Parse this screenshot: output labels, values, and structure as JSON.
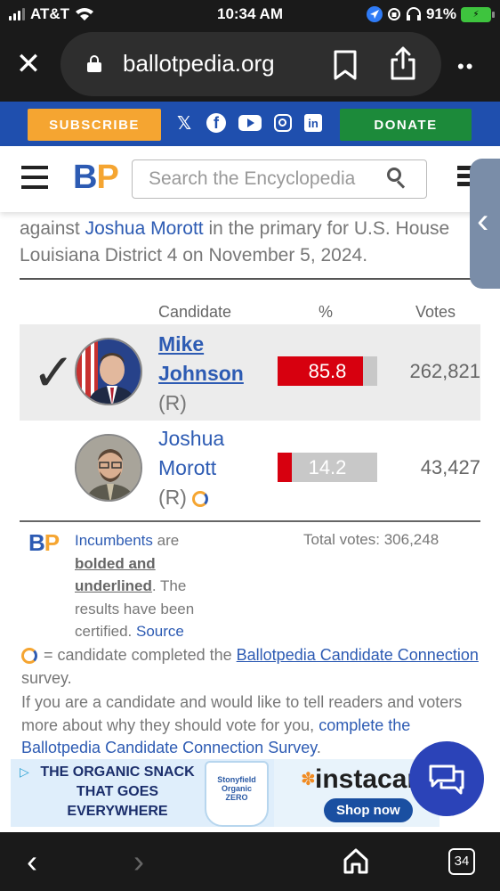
{
  "status_bar": {
    "carrier": "AT&T",
    "time": "10:34 AM",
    "battery": "91%"
  },
  "browser": {
    "url": "ballotpedia.org"
  },
  "site_bar": {
    "subscribe": "SUBSCRIBE",
    "donate": "DONATE",
    "social": [
      "x-icon",
      "facebook-icon",
      "youtube-icon",
      "instagram-icon",
      "linkedin-icon"
    ]
  },
  "site_header": {
    "logo_b": "B",
    "logo_p": "P",
    "search_placeholder": "Search the Encyclopedia"
  },
  "intro": {
    "text1": "against ",
    "link": "Joshua Morott",
    "text2": " in the primary for U.S. House Louisiana District 4 on November 5, 2024."
  },
  "table": {
    "headers": {
      "candidate": "Candidate",
      "percent": "%",
      "votes": "Votes"
    },
    "rows": [
      {
        "name_line1": "Mike",
        "name_line2": "Johnson",
        "party": "(R)",
        "percent": "85.8",
        "percent_value": 85.8,
        "votes": "262,821",
        "winner": true,
        "incumbent": true
      },
      {
        "name_line1": "Joshua",
        "name_line2": "Morott",
        "party": "(R)",
        "percent": "14.2",
        "percent_value": 14.2,
        "votes": "43,427",
        "winner": false,
        "incumbent": false
      }
    ]
  },
  "footnote": {
    "logo_b": "B",
    "logo_p": "P",
    "incumbents": "Incumbents",
    "are": " are",
    "bolded": "bolded and underlined",
    "rest": ". The results have been certified. ",
    "source": "Source",
    "total_votes": "Total votes: 306,248"
  },
  "cc_line": {
    "text1": " = candidate completed the ",
    "link": "Ballotpedia Candidate Connection",
    "text2": " survey."
  },
  "cand_line": {
    "text1": "If you are a candidate and would like to tell readers and voters more about why they should vote for you, ",
    "link": "complete the Ballotpedia Candidate Connection Survey",
    "text2": "."
  },
  "ad": {
    "headline": "THE ORGANIC SNACK THAT GOES EVERYWHERE",
    "product": "Stonyfield Organic ZERO",
    "brand": "instacart",
    "cta": "Shop now"
  },
  "bottom_bar": {
    "tab_count": "34"
  },
  "colors": {
    "brand_blue": "#1f4fae",
    "subscribe_orange": "#f5a531",
    "donate_green": "#1c8a3a",
    "vote_red": "#d7000f"
  }
}
